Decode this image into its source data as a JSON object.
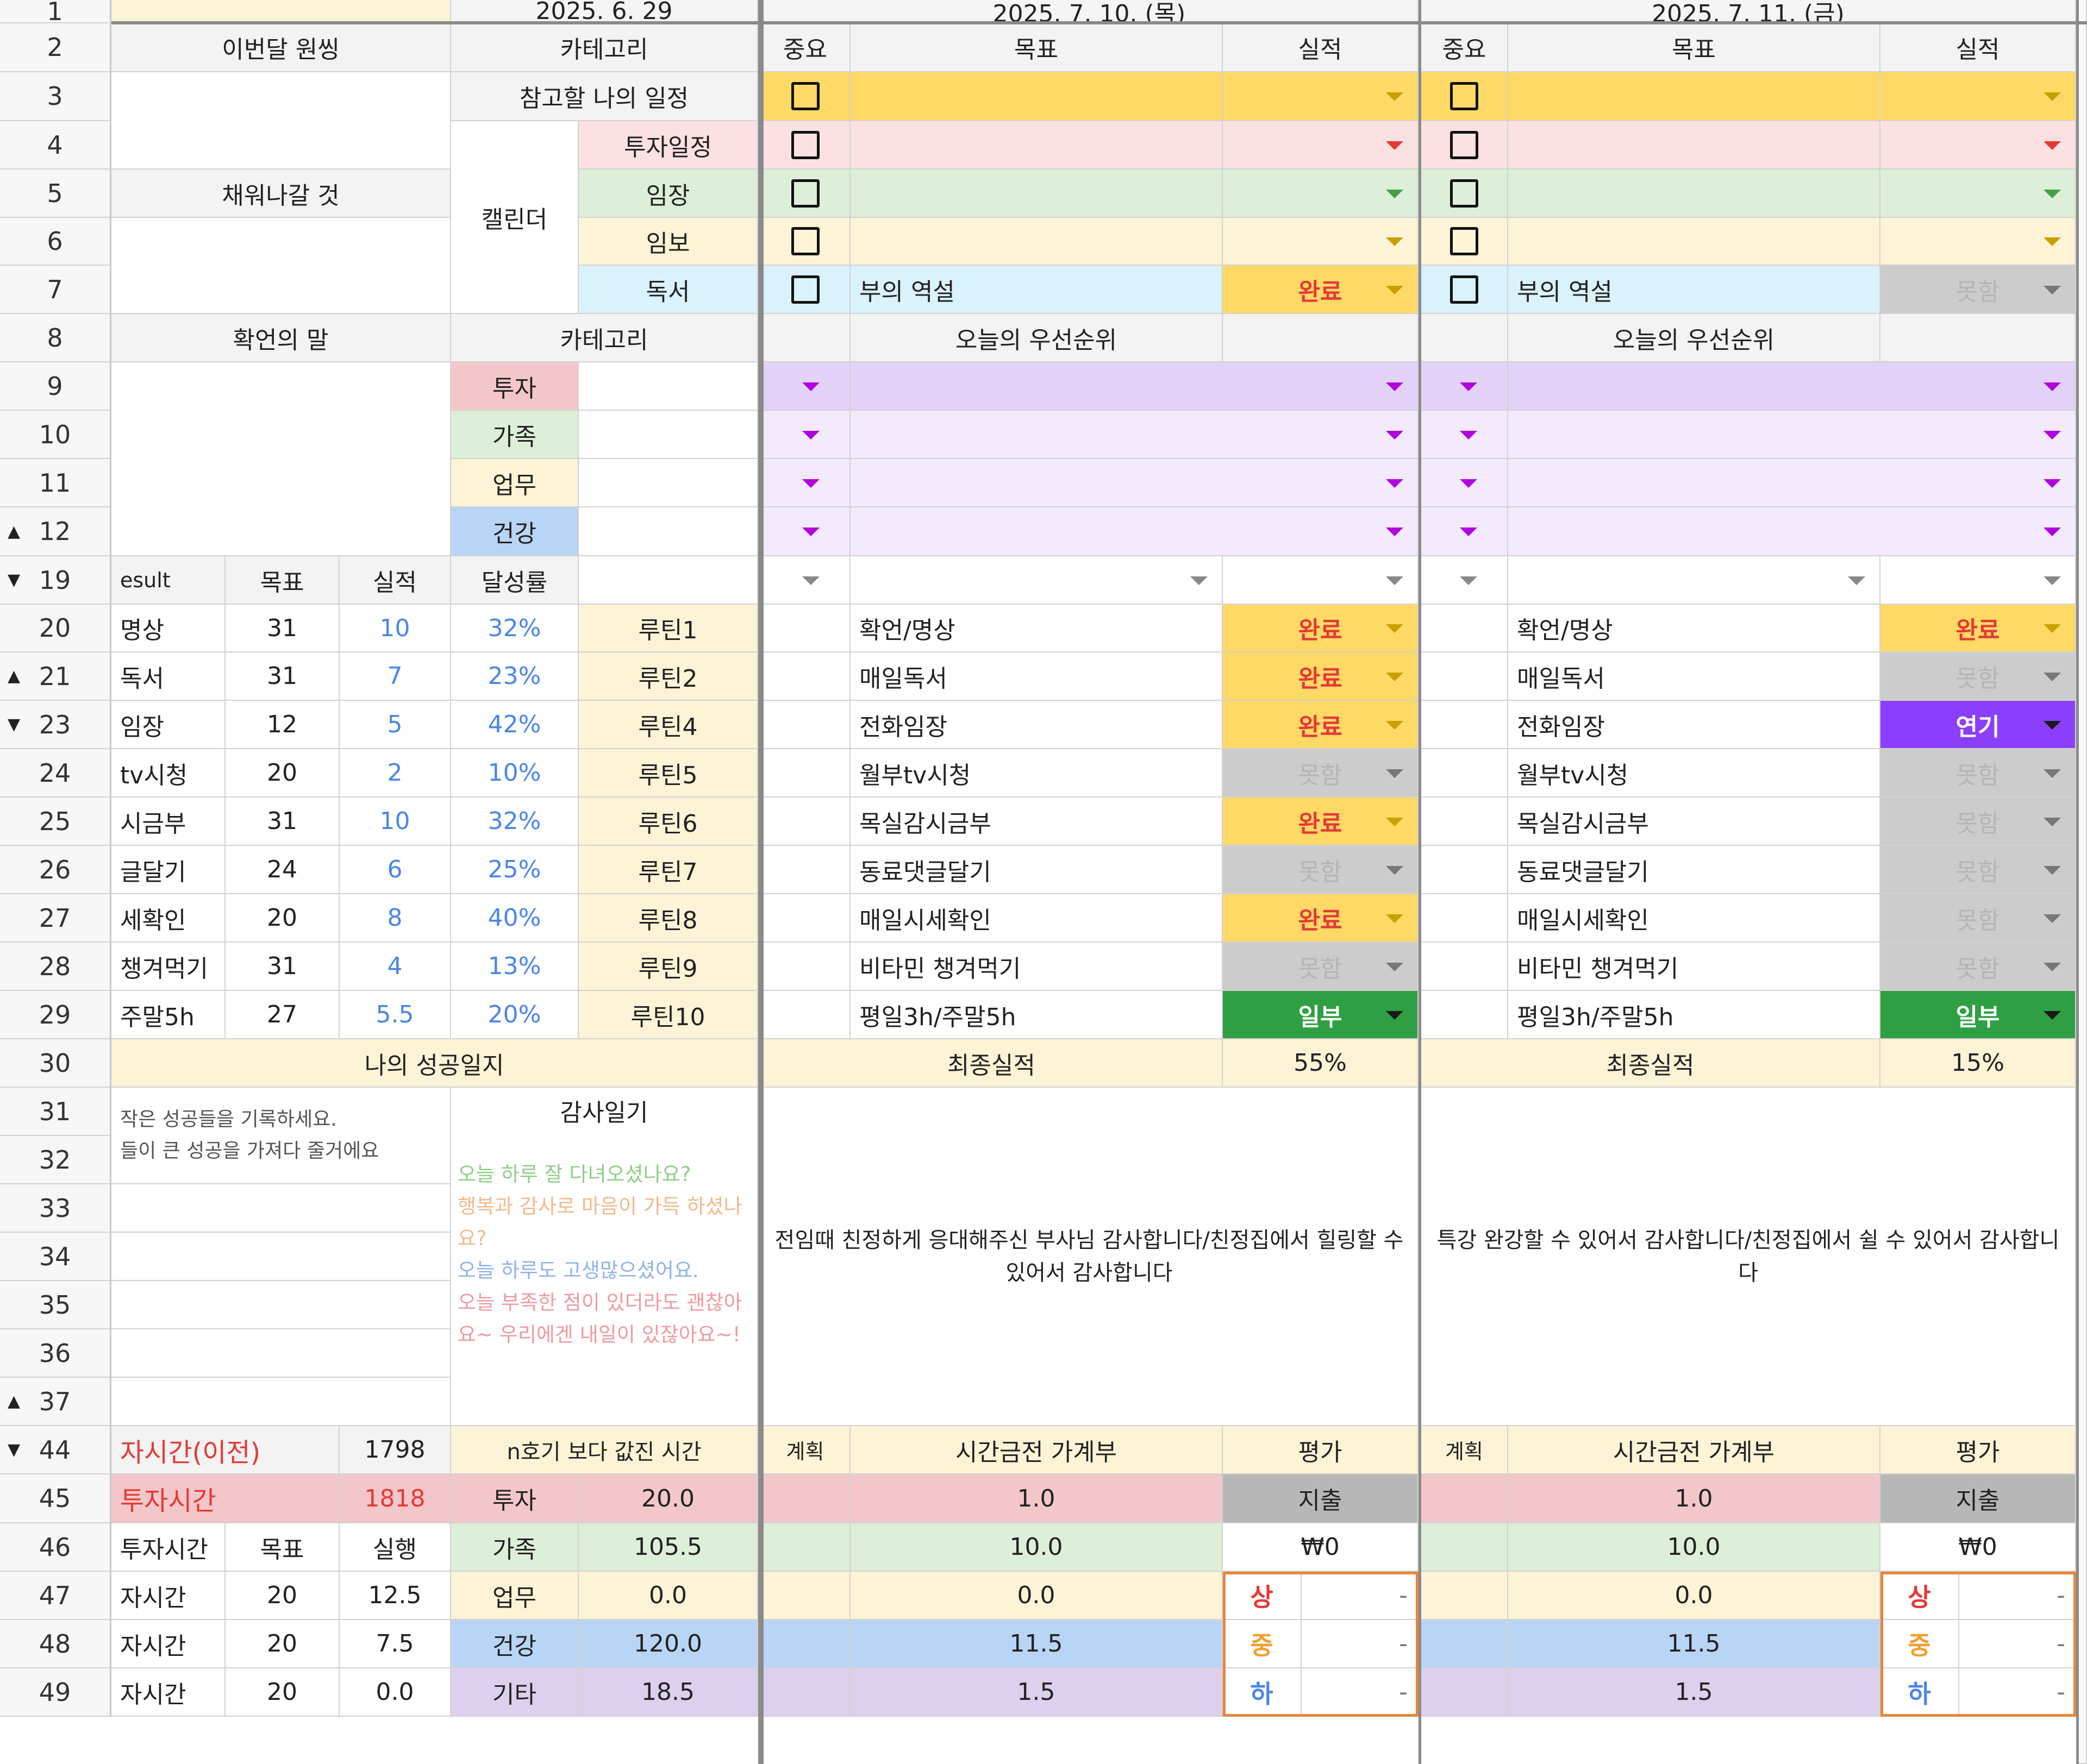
{
  "colors": {
    "yellow": "#ffd966",
    "pink": "#fbe1e1",
    "green": "#deefd9",
    "cream": "#fdf3d6",
    "cyan": "#d9f2fb",
    "lavender": "#e3d2f8",
    "lightlav": "#f3eafd",
    "gray": "#cccccc",
    "darkgreen": "#2ea043",
    "violet": "#8a3ffc",
    "blue_cat": "#b9d5f5",
    "purple_cat": "#dcd0ee",
    "red_cat": "#f3c7c9"
  },
  "rows": [
    "1",
    "2",
    "3",
    "4",
    "5",
    "6",
    "7",
    "8",
    "9",
    "10",
    "11",
    "12",
    "19",
    "20",
    "21",
    "23",
    "24",
    "25",
    "26",
    "27",
    "28",
    "29",
    "30",
    "31",
    "32",
    "33",
    "34",
    "35",
    "36",
    "37",
    "44",
    "45",
    "46",
    "47",
    "48",
    "49"
  ],
  "left": {
    "date": "2025. 6. 29",
    "monthly_wish": "이번달 원씽",
    "category": "카테고리",
    "ref_schedule": "참고할 나의 일정",
    "calendar": "캘린더",
    "invest_schedule": "투자일정",
    "imjang": "임장",
    "imbo": "임보",
    "reading": "독서",
    "to_fill": "채워나갈 것",
    "affirmation": "확언의 말",
    "category2": "카테고리",
    "cat_invest": "투자",
    "cat_family": "가족",
    "cat_work": "업무",
    "cat_health": "건강",
    "result_header": [
      "esult",
      "목표",
      "실적",
      "달성률"
    ],
    "routines": [
      {
        "name": "명상",
        "goal": "31",
        "actual": "10",
        "rate": "32%",
        "label": "루틴1"
      },
      {
        "name": "독서",
        "goal": "31",
        "actual": "7",
        "rate": "23%",
        "label": "루틴2"
      },
      {
        "name": "임장",
        "goal": "12",
        "actual": "5",
        "rate": "42%",
        "label": "루틴4"
      },
      {
        "name": "tv시청",
        "goal": "20",
        "actual": "2",
        "rate": "10%",
        "label": "루틴5"
      },
      {
        "name": "시금부",
        "goal": "31",
        "actual": "10",
        "rate": "32%",
        "label": "루틴6"
      },
      {
        "name": "글달기",
        "goal": "24",
        "actual": "6",
        "rate": "25%",
        "label": "루틴7"
      },
      {
        "name": "세확인",
        "goal": "20",
        "actual": "8",
        "rate": "40%",
        "label": "루틴8"
      },
      {
        "name": "챙겨먹기",
        "goal": "31",
        "actual": "4",
        "rate": "13%",
        "label": "루틴9"
      },
      {
        "name": "주말5h",
        "goal": "27",
        "actual": "5.5",
        "rate": "20%",
        "label": "루틴10"
      }
    ],
    "success_title": "나의 성공일지",
    "success_hint1": "작은 성공들을 기록하세요.",
    "success_hint2": "들이 큰 성공을 가져다 줄거에요",
    "gratitude_title": "감사일기",
    "gratitude_lines": [
      {
        "text": "오늘 하루 잘 다녀오셨나요?",
        "color": "#8fce86"
      },
      {
        "text": "행복과 감사로 마음이 가득 하셨나요?",
        "color": "#f3b98a"
      },
      {
        "text": "오늘 하루도 고생많으셨어요.",
        "color": "#8fb2e8"
      },
      {
        "text": "오늘 부족한 점이 있더라도 괜찮아요~ 우리에겐 내일이 있잖아요~!",
        "color": "#f09aa0"
      }
    ],
    "invest_prev_label": "자시간(이전)",
    "invest_prev_value": "1798",
    "invest_total_label": "투자시간",
    "invest_total_value": "1818",
    "invest_header": [
      "투자시간",
      "목표",
      "실행"
    ],
    "invest_rows": [
      {
        "label": "자시간",
        "goal": "20",
        "actual": "12.5"
      },
      {
        "label": "자시간",
        "goal": "20",
        "actual": "7.5"
      },
      {
        "label": "자시간",
        "goal": "20",
        "actual": "0.0"
      }
    ],
    "compare_title": "n호기 보다 값진 시간",
    "compare_rows": [
      {
        "cat": "투자",
        "val": "20.0"
      },
      {
        "cat": "가족",
        "val": "105.5"
      },
      {
        "cat": "업무",
        "val": "0.0"
      },
      {
        "cat": "건강",
        "val": "120.0"
      },
      {
        "cat": "기타",
        "val": "18.5"
      }
    ]
  },
  "days": [
    {
      "date": "2025. 7. 10. (목)",
      "hdr": [
        "중요",
        "목표",
        "실적"
      ],
      "schedule": [
        {
          "text": "",
          "status": ""
        },
        {
          "text": "",
          "status": ""
        },
        {
          "text": "",
          "status": ""
        },
        {
          "text": "",
          "status": ""
        },
        {
          "text": "부의 역설",
          "status": "완료"
        }
      ],
      "priority_title": "오늘의 우선순위",
      "routines": [
        {
          "text": "확언/명상",
          "status": "완료"
        },
        {
          "text": "매일독서",
          "status": "완료"
        },
        {
          "text": "전화임장",
          "status": "완료"
        },
        {
          "text": "월부tv시청",
          "status": "못함"
        },
        {
          "text": "목실감시금부",
          "status": "완료"
        },
        {
          "text": "동료댓글달기",
          "status": "못함"
        },
        {
          "text": "매일시세확인",
          "status": "완료"
        },
        {
          "text": "비타민 챙겨먹기",
          "status": "못함"
        },
        {
          "text": "평일3h/주말5h",
          "status": "일부"
        }
      ],
      "final_label": "최종실적",
      "final_value": "55%",
      "gratitude": "전임때 친정하게 응대해주신 부사님 감사합니다/친정집에서 힐링할 수 있어서 감사합니다",
      "budget_hdr": [
        "계획",
        "시간금전 가계부",
        "평가"
      ],
      "budget": [
        "1.0",
        "10.0",
        "0.0",
        "11.5",
        "1.5"
      ],
      "expense_label": "지출",
      "money": "₩0",
      "grades": [
        "상",
        "중",
        "하"
      ],
      "grade_vals": [
        "-",
        "-",
        "-"
      ]
    },
    {
      "date": "2025. 7. 11. (금)",
      "hdr": [
        "중요",
        "목표",
        "실적"
      ],
      "schedule": [
        {
          "text": "",
          "status": ""
        },
        {
          "text": "",
          "status": ""
        },
        {
          "text": "",
          "status": ""
        },
        {
          "text": "",
          "status": ""
        },
        {
          "text": "부의 역설",
          "status": "못함"
        }
      ],
      "priority_title": "오늘의 우선순위",
      "routines": [
        {
          "text": "확언/명상",
          "status": "완료"
        },
        {
          "text": "매일독서",
          "status": "못함"
        },
        {
          "text": "전화임장",
          "status": "연기"
        },
        {
          "text": "월부tv시청",
          "status": "못함"
        },
        {
          "text": "목실감시금부",
          "status": "못함"
        },
        {
          "text": "동료댓글달기",
          "status": "못함"
        },
        {
          "text": "매일시세확인",
          "status": "못함"
        },
        {
          "text": "비타민 챙겨먹기",
          "status": "못함"
        },
        {
          "text": "평일3h/주말5h",
          "status": "일부"
        }
      ],
      "final_label": "최종실적",
      "final_value": "15%",
      "gratitude": "특강 완강할 수 있어서 감사합니다/친정집에서 쉴 수 있어서 감사합니다",
      "budget_hdr": [
        "계획",
        "시간금전 가계부",
        "평가"
      ],
      "budget": [
        "1.0",
        "10.0",
        "0.0",
        "11.5",
        "1.5"
      ],
      "expense_label": "지출",
      "money": "₩0",
      "grades": [
        "상",
        "중",
        "하"
      ],
      "grade_vals": [
        "-",
        "-",
        "-"
      ]
    }
  ]
}
